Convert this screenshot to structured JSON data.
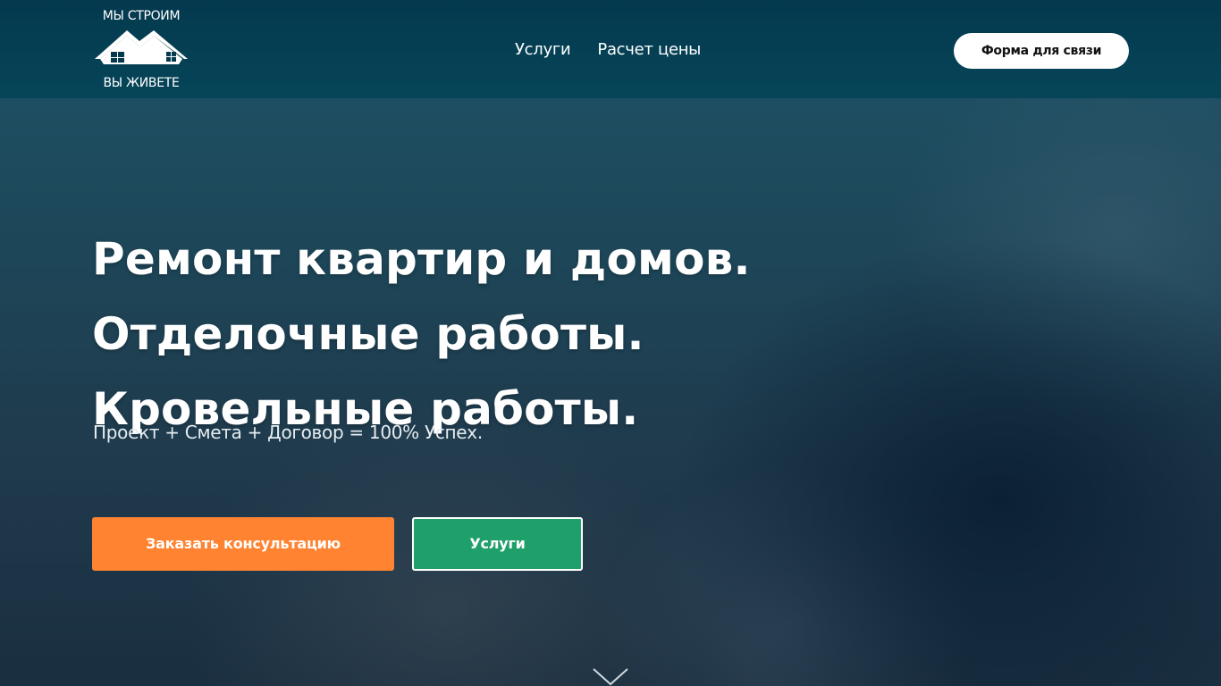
{
  "header": {
    "logo": {
      "top_text": "МЫ СТРОИМ",
      "bottom_text": "ВЫ ЖИВЕТЕ"
    },
    "nav": [
      {
        "label": "Услуги"
      },
      {
        "label": "Расчет цены"
      }
    ],
    "contact_button": "Форма для связи"
  },
  "hero": {
    "headline_lines": [
      "Ремонт квартир и домов.",
      "Отделочные работы.",
      "Кровельные работы."
    ],
    "subheadline": "Проект + Смета + Договор = 100% Успех.",
    "primary_button": "Заказать консультацию",
    "secondary_button": "Услуги",
    "scroll_icon": "chevron-down-icon"
  },
  "colors": {
    "header_bg": "#04394e",
    "primary_button": "#ff8330",
    "secondary_button": "#1fa06a",
    "text": "#ffffff"
  }
}
